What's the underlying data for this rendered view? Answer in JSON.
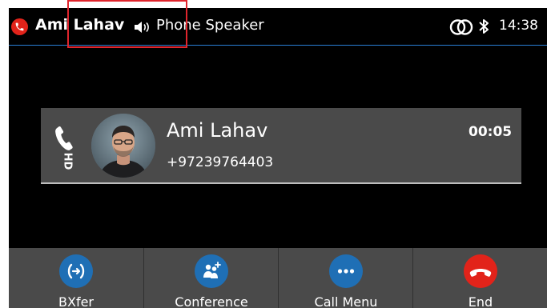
{
  "statusbar": {
    "caller_name": "Ami Lahav",
    "audio_device": "Phone Speaker",
    "time": "14:38"
  },
  "call": {
    "contact_name": "Ami Lahav",
    "contact_number": "+97239764403",
    "duration": "00:05",
    "hd_badge": "HD"
  },
  "softkeys": [
    {
      "label": "BXfer",
      "icon": "transfer-icon"
    },
    {
      "label": "Conference",
      "icon": "conference-icon"
    },
    {
      "label": "Call Menu",
      "icon": "more-icon"
    },
    {
      "label": "End",
      "icon": "hangup-icon"
    }
  ],
  "colors": {
    "accent_blue": "#1f6fb5",
    "end_red": "#e2231a",
    "card_gray": "#4a4a4a",
    "highlight_red": "#e0252d"
  }
}
